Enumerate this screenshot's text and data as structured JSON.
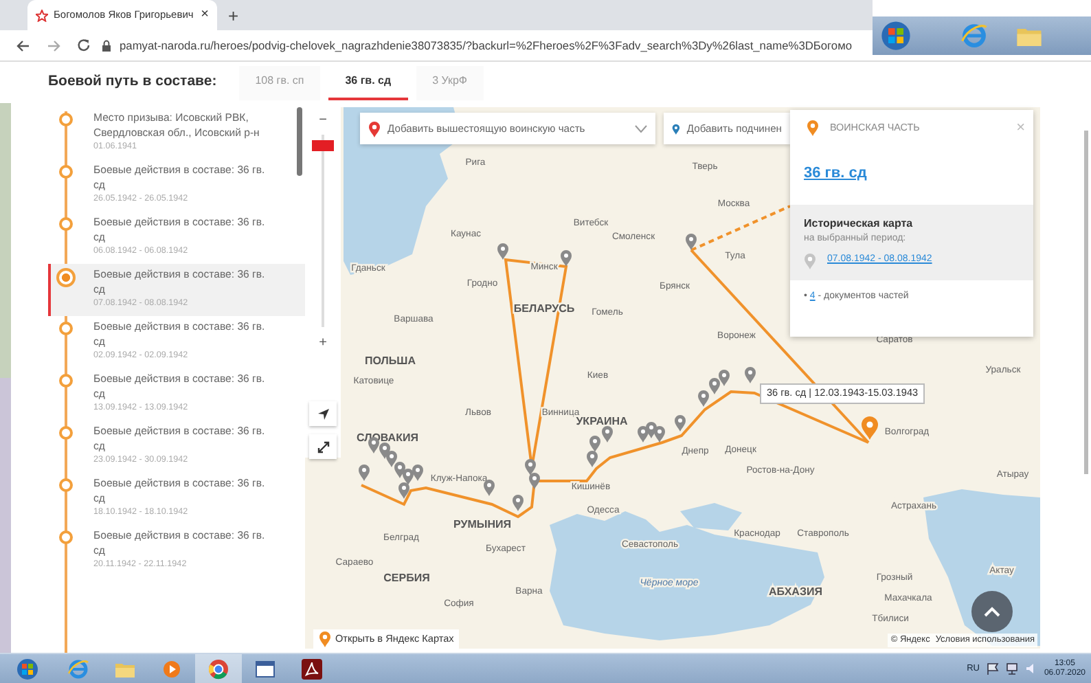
{
  "browser": {
    "tab_title": "Богомолов Яков Григорьевич",
    "close": "×",
    "new_tab": "+",
    "url": "pamyat-naroda.ru/heroes/podvig-chelovek_nagrazhdenie38073835/?backurl=%2Fheroes%2F%3Fadv_search%3Dy%26last_name%3DБогомо"
  },
  "heading": "Боевой путь в составе:",
  "unit_tabs": [
    {
      "label": "108 гв. сп",
      "selected": false
    },
    {
      "label": "36 гв. сд",
      "selected": true
    },
    {
      "label": "3 УкрФ",
      "selected": false
    }
  ],
  "timeline": [
    {
      "title": "Место призыва: Исовский РВК, Свердловская обл., Исовский р-н",
      "date": "01.06.1941",
      "selected": false
    },
    {
      "title": "Боевые действия в составе: 36 гв. сд",
      "date": "26.05.1942 - 26.05.1942",
      "selected": false
    },
    {
      "title": "Боевые действия в составе: 36 гв. сд",
      "date": "06.08.1942 - 06.08.1942",
      "selected": false
    },
    {
      "title": "Боевые действия в составе: 36 гв. сд",
      "date": "07.08.1942 - 08.08.1942",
      "selected": true
    },
    {
      "title": "Боевые действия в составе: 36 гв. сд",
      "date": "02.09.1942 - 02.09.1942",
      "selected": false
    },
    {
      "title": "Боевые действия в составе: 36 гв. сд",
      "date": "13.09.1942 - 13.09.1942",
      "selected": false
    },
    {
      "title": "Боевые действия в составе: 36 гв. сд",
      "date": "23.09.1942 - 30.09.1942",
      "selected": false
    },
    {
      "title": "Боевые действия в составе: 36 гв. сд",
      "date": "18.10.1942 - 18.10.1942",
      "selected": false
    },
    {
      "title": "Боевые действия в составе: 36 гв. сд",
      "date": "20.11.1942 - 22.11.1942",
      "selected": false
    }
  ],
  "map": {
    "zoom": {
      "minus": "−",
      "plus": "+",
      "level": 0.06
    },
    "fields": [
      {
        "kind": "superior",
        "label": "Добавить вышестоящую воинскую часть"
      },
      {
        "kind": "subordinate",
        "label": "Добавить подчинен"
      }
    ],
    "places": [
      {
        "name": "Рига",
        "kind": "city"
      },
      {
        "name": "Тверь",
        "kind": "city"
      },
      {
        "name": "Москва",
        "kind": "city"
      },
      {
        "name": "Каунас",
        "kind": "city"
      },
      {
        "name": "Витебск",
        "kind": "city"
      },
      {
        "name": "Смоленск",
        "kind": "city"
      },
      {
        "name": "Тула",
        "kind": "city"
      },
      {
        "name": "Гданьск",
        "kind": "city"
      },
      {
        "name": "Минск",
        "kind": "city"
      },
      {
        "name": "Гродно",
        "kind": "city"
      },
      {
        "name": "Брянск",
        "kind": "city"
      },
      {
        "name": "БЕЛАРУСЬ",
        "kind": "country"
      },
      {
        "name": "Гомель",
        "kind": "city"
      },
      {
        "name": "Варшава",
        "kind": "city"
      },
      {
        "name": "Воронеж",
        "kind": "city"
      },
      {
        "name": "Саратов",
        "kind": "city"
      },
      {
        "name": "ПОЛЬША",
        "kind": "country"
      },
      {
        "name": "Уральск",
        "kind": "city"
      },
      {
        "name": "Катовице",
        "kind": "city"
      },
      {
        "name": "Киев",
        "kind": "city"
      },
      {
        "name": "Львов",
        "kind": "city"
      },
      {
        "name": "Винница",
        "kind": "city"
      },
      {
        "name": "СЛОВАКИЯ",
        "kind": "country"
      },
      {
        "name": "УКРАИНА",
        "kind": "country"
      },
      {
        "name": "Днепр",
        "kind": "city"
      },
      {
        "name": "Донецк",
        "kind": "city"
      },
      {
        "name": "Волгоград",
        "kind": "city"
      },
      {
        "name": "Ростов-на-Дону",
        "kind": "city"
      },
      {
        "name": "Клуж-Напока",
        "kind": "city"
      },
      {
        "name": "Кишинёв",
        "kind": "city"
      },
      {
        "name": "Атырау",
        "kind": "city"
      },
      {
        "name": "РУМЫНИЯ",
        "kind": "country"
      },
      {
        "name": "Одесса",
        "kind": "city"
      },
      {
        "name": "Астрахань",
        "kind": "city"
      },
      {
        "name": "Краснодар",
        "kind": "city"
      },
      {
        "name": "Ставрополь",
        "kind": "city"
      },
      {
        "name": "Белград",
        "kind": "city"
      },
      {
        "name": "Севастополь",
        "kind": "city"
      },
      {
        "name": "Бухарест",
        "kind": "city"
      },
      {
        "name": "Сараево",
        "kind": "city"
      },
      {
        "name": "Актау",
        "kind": "city"
      },
      {
        "name": "Грозный",
        "kind": "city"
      },
      {
        "name": "СЕРБИЯ",
        "kind": "country"
      },
      {
        "name": "Чёрное море",
        "kind": "sea"
      },
      {
        "name": "Варна",
        "kind": "city"
      },
      {
        "name": "АБХАЗИЯ",
        "kind": "country"
      },
      {
        "name": "Махачкала",
        "kind": "city"
      },
      {
        "name": "София",
        "kind": "city"
      },
      {
        "name": "Тбилиси",
        "kind": "city"
      }
    ],
    "tooltip": "36 гв. сд | 12.03.1943-15.03.1943",
    "panel": {
      "caption": "ВОИНСКАЯ ЧАСТЬ",
      "close": "×",
      "unit": "36 гв. сд",
      "history_title": "Историческая карта",
      "history_sub": "на выбранный период:",
      "period": "07.08.1942 - 08.08.1942",
      "bullet": "•",
      "docs_count": "4",
      "docs_label": " - документов частей"
    },
    "open_link": "Открыть в Яндекс Картах",
    "copyright": "© Яндекс",
    "terms": "Условия использования"
  },
  "taskbar": {
    "lang": "RU",
    "time": "13:05",
    "date": "06.07.2020"
  }
}
